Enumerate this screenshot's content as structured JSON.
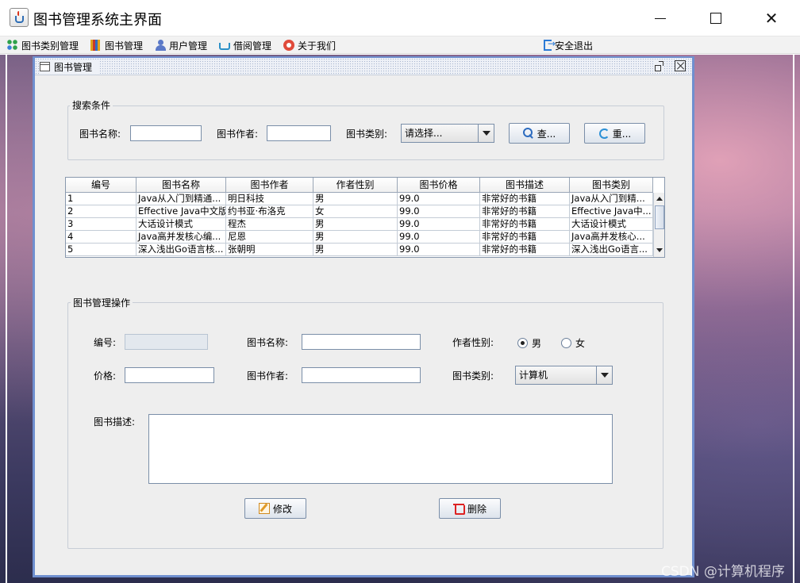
{
  "window": {
    "title": "图书管理系统主界面",
    "icon": "java-cup-icon"
  },
  "menubar": {
    "items": [
      {
        "label": "图书类别管理",
        "icon": "category-grid-icon"
      },
      {
        "label": "图书管理",
        "icon": "books-icon"
      },
      {
        "label": "用户管理",
        "icon": "user-icon"
      },
      {
        "label": "借阅管理",
        "icon": "cart-icon"
      },
      {
        "label": "关于我们",
        "icon": "about-icon"
      }
    ],
    "exit_label": "安全退出"
  },
  "frame": {
    "title": "图书管理"
  },
  "search": {
    "group_title": "搜索条件",
    "name_label": "图书名称:",
    "name_value": "",
    "author_label": "图书作者:",
    "author_value": "",
    "category_label": "图书类别:",
    "category_value": "请选择...",
    "query_label": "查...",
    "reset_label": "重..."
  },
  "table": {
    "columns": [
      "编号",
      "图书名称",
      "图书作者",
      "作者性别",
      "图书价格",
      "图书描述",
      "图书类别"
    ],
    "rows": [
      [
        "1",
        "Java从入门到精通...",
        "明日科技",
        "男",
        "99.0",
        "非常好的书籍",
        "Java从入门到精..."
      ],
      [
        "2",
        "Effective Java中文版",
        "约书亚·布洛克",
        "女",
        "99.0",
        "非常好的书籍",
        "Effective Java中..."
      ],
      [
        "3",
        "大话设计模式",
        "程杰",
        "男",
        "99.0",
        "非常好的书籍",
        "大话设计模式"
      ],
      [
        "4",
        "Java高并发核心编...",
        "尼恩",
        "男",
        "99.0",
        "非常好的书籍",
        "Java高并发核心..."
      ],
      [
        "5",
        "深入浅出Go语言核...",
        "张朝明",
        "男",
        "99.0",
        "非常好的书籍",
        "深入浅出Go语言..."
      ]
    ]
  },
  "edit": {
    "group_title": "图书管理操作",
    "id_label": "编号:",
    "id_value": "",
    "name_label": "图书名称:",
    "name_value": "",
    "gender_label": "作者性别:",
    "gender_male": "男",
    "gender_female": "女",
    "gender_selected": "男",
    "price_label": "价格:",
    "price_value": "",
    "author_label": "图书作者:",
    "author_value": "",
    "category_label": "图书类别:",
    "category_value": "计算机",
    "desc_label": "图书描述:",
    "desc_value": "",
    "modify_label": "修改",
    "delete_label": "删除"
  },
  "watermark": "CSDN @计算机程序",
  "colors": {
    "frame_border": "#6f8fcf",
    "panel_bg": "#eeeeee"
  }
}
